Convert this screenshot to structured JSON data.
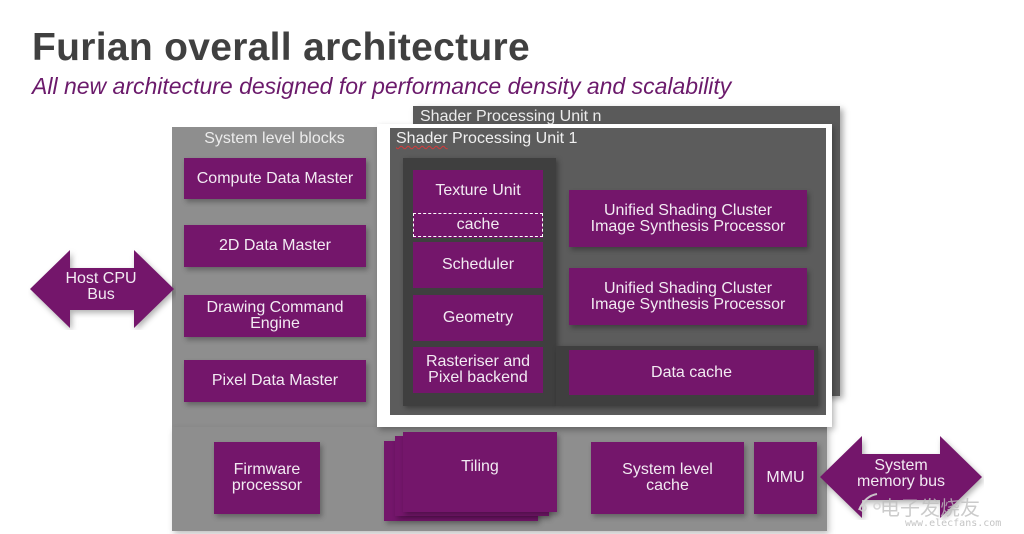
{
  "slide": {
    "title": "Furian overall architecture",
    "subtitle": "All new architecture designed for performance density and scalability"
  },
  "colors": {
    "block_purple": "#74166b",
    "subtitle_purple": "#6b1a6b",
    "system_gray": "#8e8e8e",
    "spu_gray": "#5c5c5c",
    "pipeline_dark": "#3f3f3f",
    "title_gray": "#404040"
  },
  "host_bus": {
    "label_line1": "Host CPU",
    "label_line2": "Bus"
  },
  "memory_bus": {
    "label_line1": "System",
    "label_line2": "memory bus"
  },
  "system_blocks": {
    "label": "System level blocks",
    "items": [
      {
        "line1": "Compute Data Master",
        "line2": ""
      },
      {
        "line1": "2D Data Master",
        "line2": ""
      },
      {
        "line1": "Drawing Command",
        "line2": "Engine"
      },
      {
        "line1": "Pixel Data Master",
        "line2": ""
      }
    ]
  },
  "spu_n": {
    "label": "Shader Processing Unit n"
  },
  "spu_1": {
    "label_prefix": "Shader",
    "label_suffix": " Processing Unit 1",
    "pipeline": [
      {
        "line1": "Texture Unit",
        "line2": ""
      },
      {
        "line1": "cache",
        "line2": ""
      },
      {
        "line1": "Scheduler",
        "line2": ""
      },
      {
        "line1": "Geometry",
        "line2": ""
      },
      {
        "line1": "Rasteriser and",
        "line2": "Pixel backend"
      }
    ],
    "clusters": [
      {
        "line1": "Unified Shading Cluster",
        "line2": "Image Synthesis Processor"
      },
      {
        "line1": "Unified Shading Cluster",
        "line2": "Image Synthesis Processor"
      }
    ],
    "data_cache": "Data cache"
  },
  "bottom_blocks": {
    "firmware": {
      "line1": "Firmware",
      "line2": "processor"
    },
    "tiling": "Tiling",
    "slc": {
      "line1": "System level",
      "line2": "cache"
    },
    "mmu": "MMU"
  },
  "watermark": {
    "text": "电子发烧友",
    "url": "www.elecfans.com"
  }
}
